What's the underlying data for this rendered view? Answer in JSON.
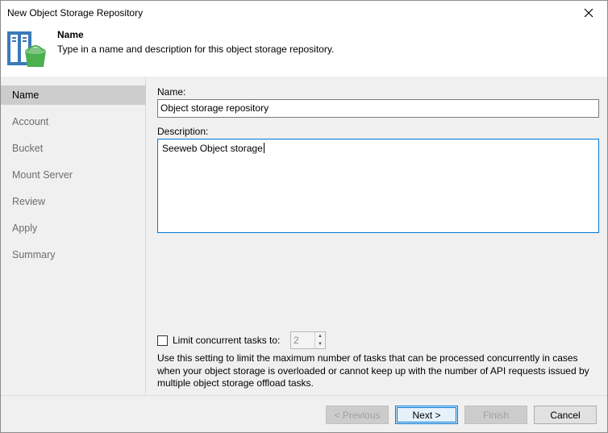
{
  "window": {
    "title": "New Object Storage Repository",
    "close_icon": "close-icon"
  },
  "header": {
    "title": "Name",
    "subtitle": "Type in a name and description for this object storage repository.",
    "icon": "object-storage-repository-icon"
  },
  "sidebar": {
    "items": [
      {
        "label": "Name",
        "active": true
      },
      {
        "label": "Account",
        "active": false
      },
      {
        "label": "Bucket",
        "active": false
      },
      {
        "label": "Mount Server",
        "active": false
      },
      {
        "label": "Review",
        "active": false
      },
      {
        "label": "Apply",
        "active": false
      },
      {
        "label": "Summary",
        "active": false
      }
    ]
  },
  "form": {
    "name_label": "Name:",
    "name_value": "Object storage repository",
    "description_label": "Description:",
    "description_value": "Seeweb Object storage",
    "limit_label": "Limit concurrent tasks to:",
    "limit_checked": false,
    "limit_value": "2",
    "hint": "Use this setting to limit the maximum number of tasks that can be processed concurrently in cases when your object storage is overloaded or cannot keep up with the number of API requests issued by multiple object storage offload tasks."
  },
  "footer": {
    "previous_label": "< Previous",
    "next_label": "Next >",
    "finish_label": "Finish",
    "cancel_label": "Cancel"
  },
  "colors": {
    "accent": "#0078d7",
    "bucket_green": "#4caf50",
    "server_blue": "#3a7ab8"
  }
}
